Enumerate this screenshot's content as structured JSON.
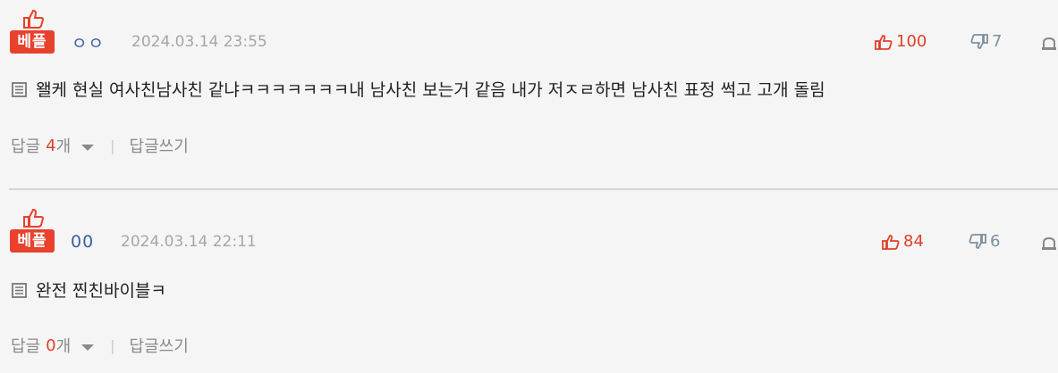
{
  "comments": [
    {
      "best_label": "베플",
      "nickname": "ㅇㅇ",
      "date": "2024.03.14 23:55",
      "upvotes": "100",
      "downvotes": "7",
      "text": "왤케 현실 여사친남사친 같냐ㅋㅋㅋㅋㅋㅋㅋ내 남사친 보는거 같음 내가 저ㅈㄹ하면 남사친 표정 썩고 고개 돌림",
      "reply_label": "답글",
      "reply_count": "4",
      "reply_unit": "개",
      "write_reply": "답글쓰기"
    },
    {
      "best_label": "베플",
      "nickname": "00",
      "date": "2024.03.14 22:11",
      "upvotes": "84",
      "downvotes": "6",
      "text": "완전 찐친바이블ㅋ",
      "reply_label": "답글",
      "reply_count": "0",
      "reply_unit": "개",
      "write_reply": "답글쓰기"
    }
  ],
  "colors": {
    "accent": "#e8412c",
    "nickname": "#3a5fa5",
    "down": "#7e8f9e"
  },
  "icons": [
    "thumbs-up-best-icon",
    "thumbs-up-icon",
    "thumbs-down-icon",
    "report-icon",
    "document-icon",
    "caret-down-icon"
  ]
}
